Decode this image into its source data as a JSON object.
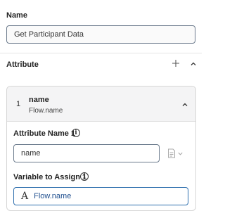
{
  "name_section": {
    "label": "Name",
    "value": "Get Participant Data"
  },
  "attribute_section": {
    "label": "Attribute",
    "add_icon": "plus-icon",
    "collapse_icon": "chevron-up-icon"
  },
  "attribute_item": {
    "index": "1",
    "title": "name",
    "subtitle": "Flow.name",
    "collapse_icon": "chevron-up-icon",
    "attribute_name_label": "Attribute Name 1",
    "attribute_name_value": "name",
    "variable_label": "Variable to Assign 1",
    "variable_value": "Flow.name",
    "variable_type_icon": "string-type-icon",
    "value_type_icon": "document-icon"
  },
  "colors": {
    "input_border": "#6b7a8c",
    "variable_border": "#2f6fae",
    "variable_text": "#1f4f8f",
    "card_header_bg": "#f4f4f5"
  }
}
